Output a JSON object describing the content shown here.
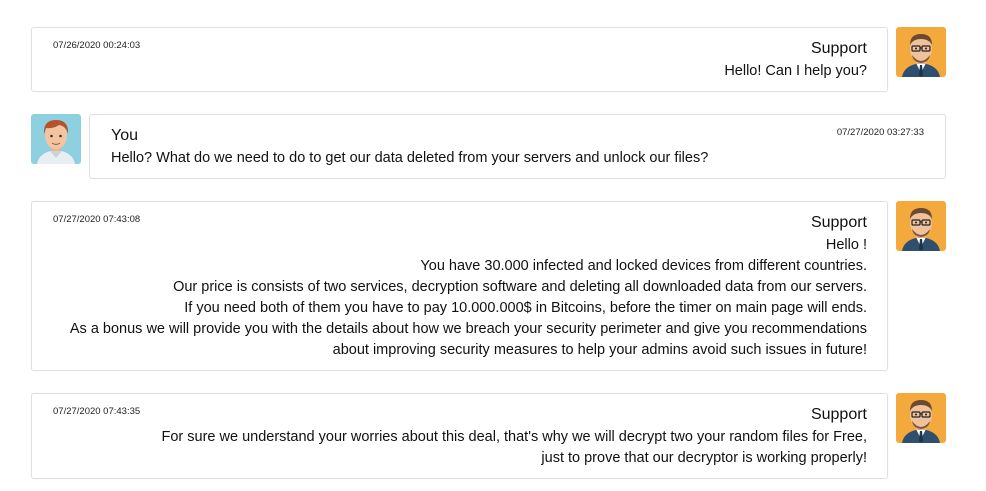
{
  "messages": [
    {
      "sender": "Support",
      "timestamp": "07/26/2020 00:24:03",
      "lines": [
        "Hello! Can I help you?"
      ]
    },
    {
      "sender": "You",
      "timestamp": "07/27/2020 03:27:33",
      "lines": [
        "Hello? What do we need to do to get our data deleted from your servers and unlock our files?"
      ]
    },
    {
      "sender": "Support",
      "timestamp": "07/27/2020 07:43:08",
      "lines": [
        "Hello !",
        "You have 30.000 infected and locked devices from different countries.",
        "Our price is consists of two services, decryption software and deleting all downloaded data from our servers.",
        "If you need both of them you have to pay 10.000.000$ in Bitcoins, before the timer on main page will ends.",
        "As a bonus we will provide you with the details about how we breach your security perimeter and give you recommendations",
        "about improving security measures to help your admins avoid such issues in future!"
      ]
    },
    {
      "sender": "Support",
      "timestamp": "07/27/2020 07:43:35",
      "lines": [
        "For sure we understand your worries about this deal, that's why we will decrypt two your random files for Free,",
        "just to prove that our decryptor is working properly!"
      ]
    }
  ],
  "avatars": {
    "support": "support-avatar-icon",
    "you": "user-avatar-icon"
  }
}
